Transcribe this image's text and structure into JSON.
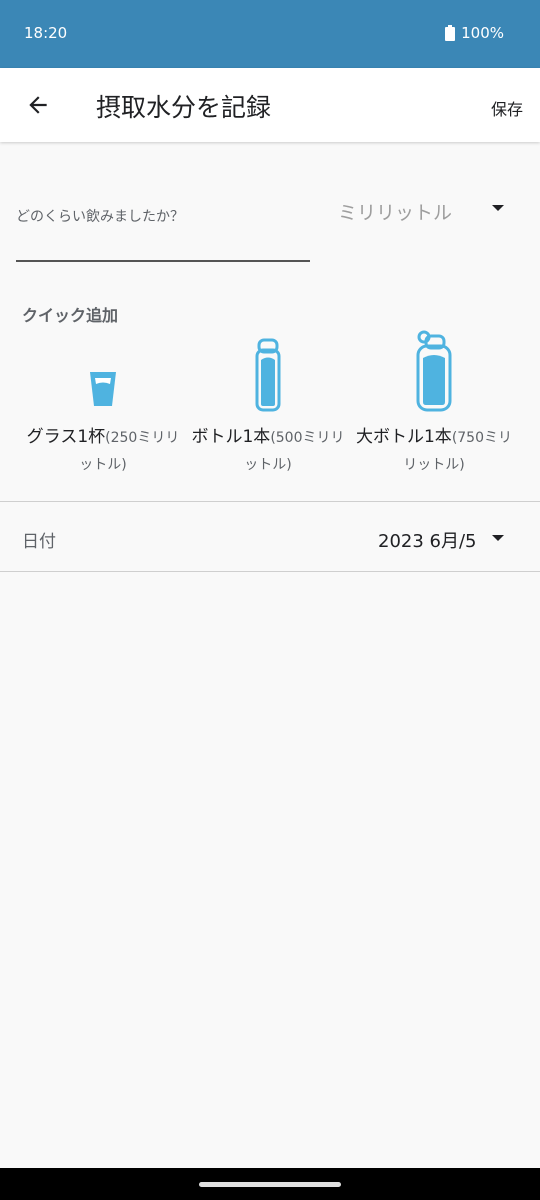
{
  "status_bar": {
    "time": "18:20",
    "battery": "100%"
  },
  "app_bar": {
    "title": "摂取水分を記録",
    "save_label": "保存"
  },
  "form": {
    "amount_label": "どのくらい飲みましたか？",
    "unit_value": "ミリリットル"
  },
  "quick_add": {
    "title": "クイック追加",
    "items": [
      {
        "main": "グラス1杯",
        "sub_line1": "(250ミリリ",
        "sub_line2": "ットル)",
        "icon": "glass-icon"
      },
      {
        "main": "ボトル1本",
        "sub_line1": "(500ミリリ",
        "sub_line2": "ットル)",
        "icon": "bottle-icon"
      },
      {
        "main": "大ボトル1本",
        "sub_line1": "(750ミリ",
        "sub_line2": "リットル)",
        "icon": "large-bottle-icon"
      }
    ]
  },
  "date_row": {
    "label": "日付",
    "value": "2023 6月/5"
  },
  "colors": {
    "status_bar": "#3b87b6",
    "icon_blue": "#4fb3e0"
  }
}
